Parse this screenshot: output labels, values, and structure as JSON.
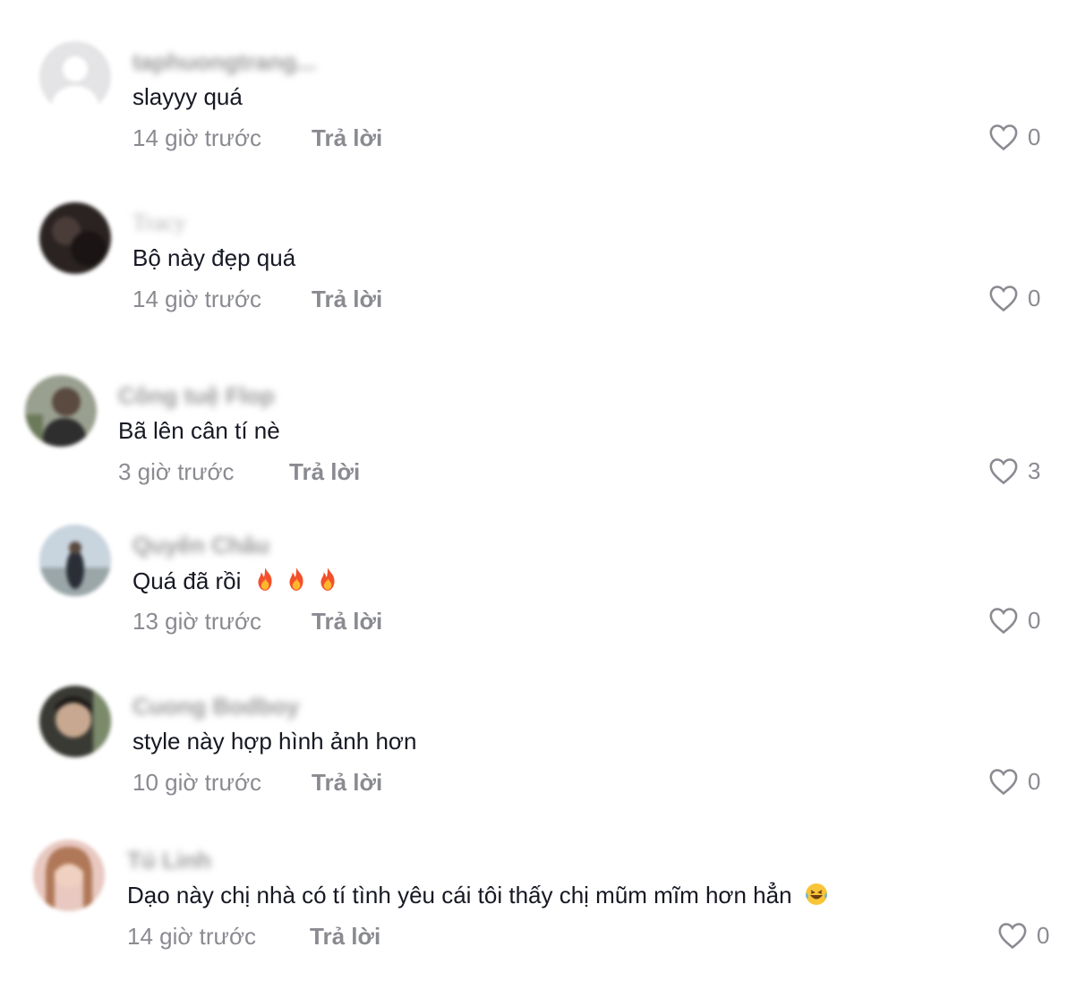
{
  "comments": [
    {
      "username": "taphuongtrang...",
      "text": "slayyy quá",
      "time": "14 giờ trước",
      "reply": "Trả lời",
      "likes": "0"
    },
    {
      "username": "Tracy",
      "text": "Bộ này đẹp quá",
      "time": "14 giờ trước",
      "reply": "Trả lời",
      "likes": "0"
    },
    {
      "username": "Công tuệ Flop",
      "text": "Bã lên cân tí nè",
      "time": "3 giờ trước",
      "reply": "Trả lời",
      "likes": "3"
    },
    {
      "username": "Quyên Châu",
      "text": "Quá đã rồi",
      "emoji": "fire-icon x3",
      "time": "13 giờ trước",
      "reply": "Trả lời",
      "likes": "0"
    },
    {
      "username": "Cuong Bodboy",
      "text": "style này hợp hình ảnh hơn",
      "time": "10 giờ trước",
      "reply": "Trả lời",
      "likes": "0"
    },
    {
      "username": "Tú Linh",
      "text": "Dạo này chị nhà có tí tình yêu cái tôi thấy chị mũm mĩm hơn hẳn",
      "emoji": "laughing-tears-icon",
      "time": "14 giờ trước",
      "reply": "Trả lời",
      "likes": "0"
    }
  ],
  "colors": {
    "text": "#161823",
    "meta": "#8a8b91",
    "username_blurred": "#9a9a9a"
  }
}
